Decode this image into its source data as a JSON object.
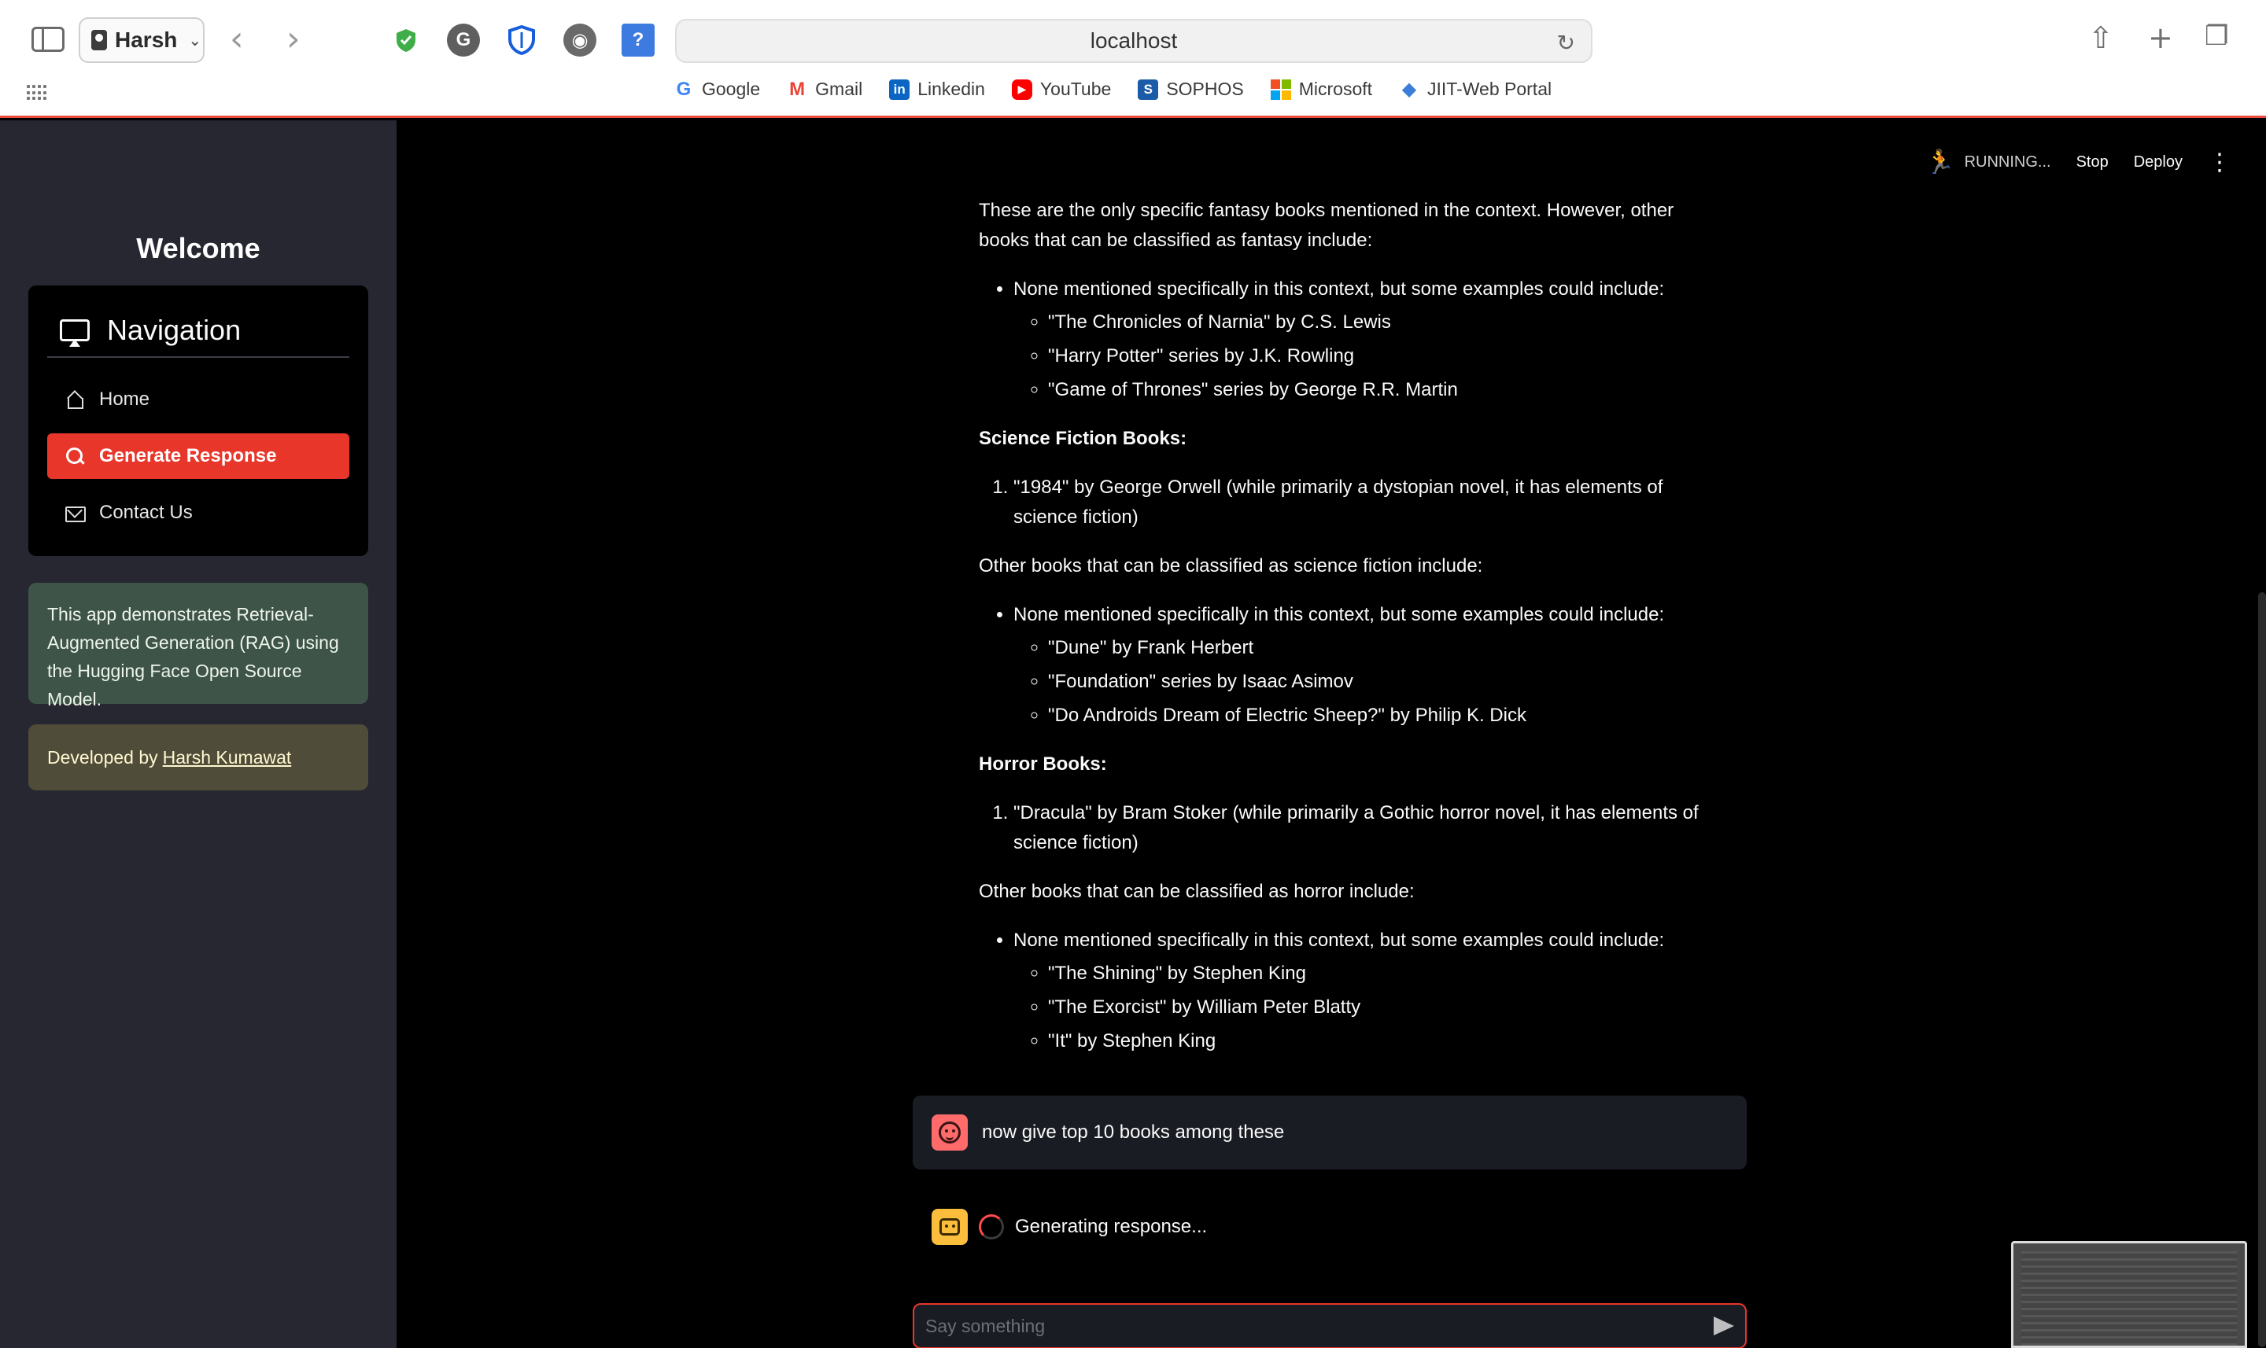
{
  "browser": {
    "profile_name": "Harsh",
    "url": "localhost",
    "bookmarks": [
      {
        "label": "Google",
        "icon": "google-icon",
        "color": "#4285F4"
      },
      {
        "label": "Gmail",
        "icon": "gmail-icon",
        "color": "#EA4335"
      },
      {
        "label": "Linkedin",
        "icon": "linkedin-icon",
        "color": "#0A66C2"
      },
      {
        "label": "YouTube",
        "icon": "youtube-icon",
        "color": "#FF0000"
      },
      {
        "label": "SOPHOS",
        "icon": "sophos-icon",
        "color": "#1C5BA8"
      },
      {
        "label": "Microsoft",
        "icon": "microsoft-icon",
        "color": "#F25022"
      },
      {
        "label": "JIIT-Web Portal",
        "icon": "jiit-icon",
        "color": "#3B7DD8"
      }
    ]
  },
  "sidebar": {
    "welcome": "Welcome",
    "nav_title": "Navigation",
    "items": [
      {
        "label": "Home",
        "icon": "home-icon",
        "active": false
      },
      {
        "label": "Generate Response",
        "icon": "search-icon",
        "active": true
      },
      {
        "label": "Contact Us",
        "icon": "mail-icon",
        "active": false
      }
    ],
    "info": "This app demonstrates Retrieval-Augmented Generation (RAG) using the Hugging Face Open Source Model.",
    "developed_by": "Developed by",
    "developer": "Harsh Kumawat",
    "accent_color": "#e8362b"
  },
  "toolbar": {
    "status": "RUNNING...",
    "stop": "Stop",
    "deploy": "Deploy"
  },
  "response": {
    "intro": "These are the only specific fantasy books mentioned in the context. However, other books that can be classified as fantasy include:",
    "fantasy_lead": "None mentioned specifically in this context, but some examples could include:",
    "fantasy_examples": [
      "\"The Chronicles of Narnia\" by C.S. Lewis",
      "\"Harry Potter\" series by J.K. Rowling",
      "\"Game of Thrones\" series by George R.R. Martin"
    ],
    "scifi_heading": "Science Fiction Books:",
    "scifi_item": "\"1984\" by George Orwell (while primarily a dystopian novel, it has elements of science fiction)",
    "scifi_other": "Other books that can be classified as science fiction include:",
    "scifi_lead": "None mentioned specifically in this context, but some examples could include:",
    "scifi_examples": [
      "\"Dune\" by Frank Herbert",
      "\"Foundation\" series by Isaac Asimov",
      "\"Do Androids Dream of Electric Sheep?\" by Philip K. Dick"
    ],
    "horror_heading": "Horror Books:",
    "horror_item": "\"Dracula\" by Bram Stoker (while primarily a Gothic horror novel, it has elements of science fiction)",
    "horror_other": "Other books that can be classified as horror include:",
    "horror_lead": "None mentioned specifically in this context, but some examples could include:",
    "horror_examples": [
      "\"The Shining\" by Stephen King",
      "\"The Exorcist\" by William Peter Blatty",
      "\"It\" by Stephen King"
    ]
  },
  "chat": {
    "user_message": "now give top 10 books among these",
    "bot_status": "Generating response...",
    "input_placeholder": "Say something"
  }
}
